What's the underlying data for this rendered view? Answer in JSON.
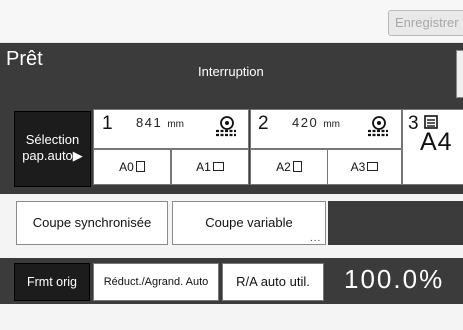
{
  "header": {
    "register_button": "Enregistrer",
    "status": "Prêt",
    "mode": "Interruption"
  },
  "paper": {
    "selection_label_line1": "Sélection",
    "selection_label_line2": "pap.auto▶",
    "trays": [
      {
        "number": "1",
        "size": "841",
        "unit": "mm"
      },
      {
        "number": "2",
        "size": "420",
        "unit": "mm"
      },
      {
        "number": "3",
        "size": "A4"
      }
    ],
    "sizes": [
      {
        "label": "A0",
        "orientation": "portrait"
      },
      {
        "label": "A1",
        "orientation": "landscape"
      },
      {
        "label": "A2",
        "orientation": "portrait"
      },
      {
        "label": "A3",
        "orientation": "landscape"
      }
    ]
  },
  "cut": {
    "sync_label": "Coupe synchronisée",
    "variable_label": "Coupe variable",
    "variable_more": "..."
  },
  "format": {
    "frmt_label": "Frmt orig",
    "reduce_label": "Réduct./Agrand. Auto",
    "ra_label": "R/A auto util.",
    "zoom": "100.0%"
  },
  "colors": {
    "panel_dark": "#3b3b3b",
    "button_selected": "#1c1c1c",
    "button_white": "#ffffff"
  }
}
